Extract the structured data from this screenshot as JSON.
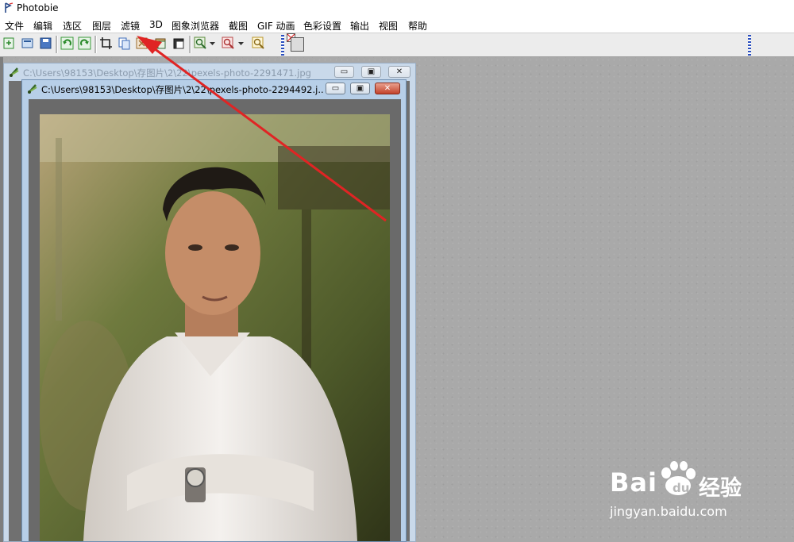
{
  "app": {
    "title": "Photobie"
  },
  "menu": [
    "文件",
    "编辑",
    "选区",
    "图层",
    "滤镜",
    "3D",
    "图象浏览器",
    "截图",
    "GIF 动画",
    "色彩设置",
    "输出",
    "视图",
    "帮助"
  ],
  "toolbar": {
    "icons": [
      "new-icon",
      "open-icon",
      "save-icon",
      "undo-icon",
      "redo-icon",
      "crop-icon",
      "copy-icon",
      "cut-icon",
      "paste-icon",
      "paste-new-icon",
      "zoom-in-icon",
      "zoom-out-icon",
      "zoom-fit-icon",
      "color-swatch-icon"
    ]
  },
  "window_back": {
    "title": "C:\\Users\\98153\\Desktop\\存图片\\2\\22\\pexels-photo-2291471.jpg"
  },
  "window_front": {
    "title": "C:\\Users\\98153\\Desktop\\存图片\\2\\22\\pexels-photo-2294492.j..."
  },
  "window_controls": {
    "minimize": "▭",
    "maximize": "▣",
    "close": "✕"
  },
  "watermark": {
    "brand": "Bai",
    "brand_cn": "经验",
    "url": "jingyan.baidu.com"
  },
  "colors": {
    "accent_close": "#c2422b",
    "arrow": "#e02424",
    "workspace": "#a9a9a9"
  }
}
